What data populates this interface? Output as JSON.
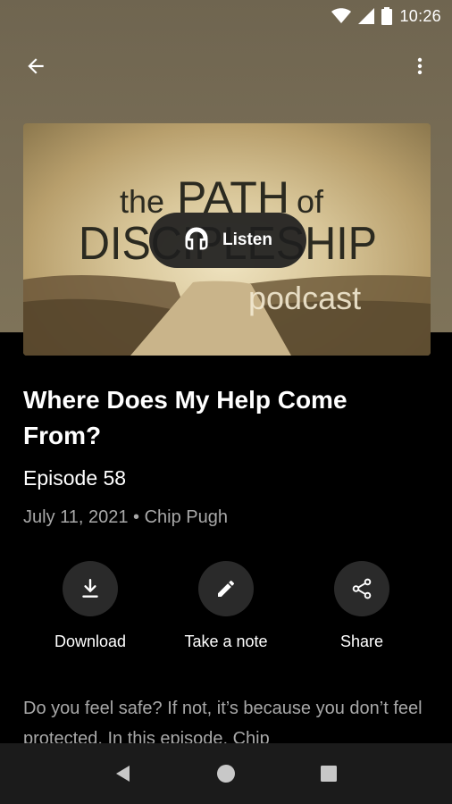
{
  "status_bar": {
    "time": "10:26",
    "icons": [
      "wifi-icon",
      "signal-icon",
      "battery-icon"
    ]
  },
  "app_bar": {
    "back_icon": "arrow-left-icon",
    "menu_icon": "more-vert-icon"
  },
  "artwork": {
    "title_line1_the": "the",
    "title_line1_path": "PATH",
    "title_line1_of": "of",
    "title_line2": "DISCIPLESHIP",
    "subtitle": "podcast"
  },
  "listen_button": {
    "label": "Listen",
    "icon": "headphones-icon"
  },
  "episode": {
    "title": "Where Does My Help Come From?",
    "number": "Episode 58",
    "meta": "July 11, 2021 • Chip Pugh"
  },
  "actions": [
    {
      "label": "Download",
      "icon": "download-icon"
    },
    {
      "label": "Take a note",
      "icon": "pencil-icon"
    },
    {
      "label": "Share",
      "icon": "share-icon"
    }
  ],
  "description": "Do you feel safe? If not, it’s because you don’t feel protected. In this episode, Chip",
  "nav_bar": {
    "icons": [
      "back-triangle-icon",
      "home-circle-icon",
      "recents-square-icon"
    ]
  },
  "colors": {
    "header_bg": "#776c55",
    "background": "#000000",
    "secondary_text": "#a8a8a8",
    "action_circle": "#2a2a2a",
    "nav_bar": "#1b1b1b"
  }
}
